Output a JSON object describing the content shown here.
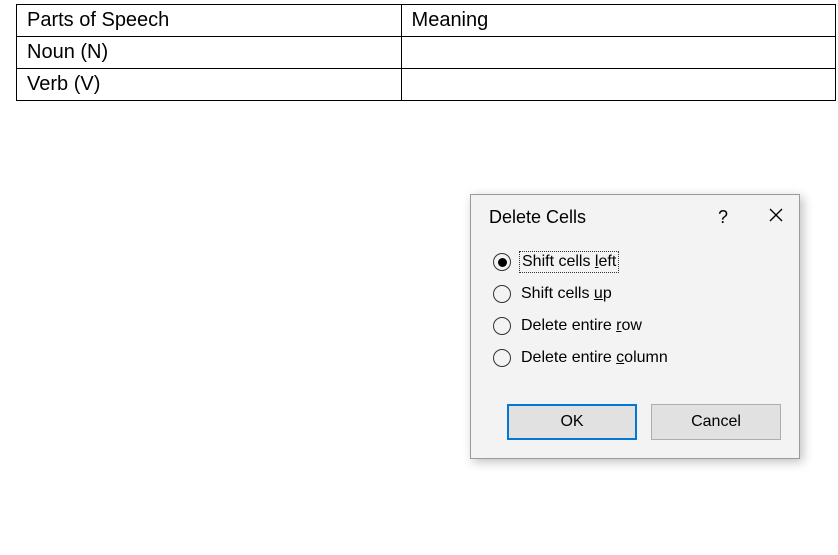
{
  "table": {
    "headers": [
      "Parts of Speech",
      "Meaning"
    ],
    "rows": [
      [
        "Noun (N)",
        ""
      ],
      [
        "Verb (V)",
        ""
      ]
    ]
  },
  "dialog": {
    "title": "Delete Cells",
    "help_symbol": "?",
    "options": [
      {
        "pre": "Shift cells ",
        "key": "l",
        "post": "eft",
        "selected": true
      },
      {
        "pre": "Shift cells ",
        "key": "u",
        "post": "p",
        "selected": false
      },
      {
        "pre": "Delete entire ",
        "key": "r",
        "post": "ow",
        "selected": false
      },
      {
        "pre": "Delete entire ",
        "key": "c",
        "post": "olumn",
        "selected": false
      }
    ],
    "ok_label": "OK",
    "cancel_label": "Cancel"
  }
}
